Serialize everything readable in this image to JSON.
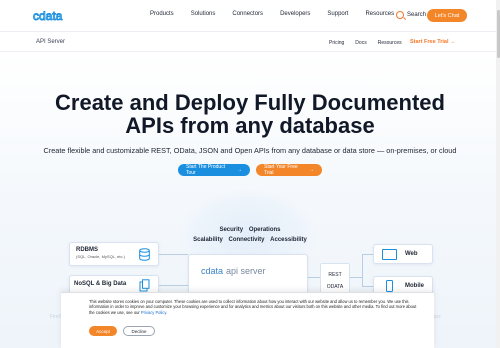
{
  "brand": {
    "logo_text": "cdata",
    "accent": "#f4862a",
    "primary": "#1a8fe0"
  },
  "topnav": {
    "links": [
      "Products",
      "Solutions",
      "Connectors",
      "Developers",
      "Support",
      "Resources"
    ],
    "search_label": "Search",
    "chat_label": "Let's Chat"
  },
  "subnav": {
    "product": "API Server",
    "links": [
      "Pricing",
      "Docs",
      "Resources"
    ],
    "trial_label": "Start Free Trial"
  },
  "hero": {
    "headline_line1": "Create and Deploy Fully Documented",
    "headline_line2": "APIs from any database",
    "subhead": "Create flexible and customizable REST, OData, JSON and Open APIs from any database or data store — on-premises, or cloud",
    "cta_tour": "Start The Product Tour",
    "cta_trial": "Start Your Free Trial"
  },
  "diagram": {
    "security": [
      "Security",
      "Operations"
    ],
    "features": [
      "Scalability",
      "Connectivity",
      "Accessibility"
    ],
    "rdbms_title": "RDBMS",
    "rdbms_sub": "(SQL, Oracle, MySQL, etc.)",
    "nosql_title": "NoSQL & Big Data",
    "core_logo": "cdata",
    "core_product": "api server",
    "rest": "REST",
    "odata": "ODATA",
    "web": "Web",
    "mobile": "Mobile",
    "faded_left": "FireSourcs",
    "faded_right": "Extensible Apps"
  },
  "cookie": {
    "text": "This website stores cookies on your computer. These cookies are used to collect information about how you interact with our website and allow us to remember you. We use this information in order to improve and customize your browsing experience and for analytics and metrics about our visitors both on this website and other media. To find out more about the cookies we use, see our",
    "link": "Privacy Policy.",
    "accept": "Accept",
    "decline": "Decline"
  }
}
